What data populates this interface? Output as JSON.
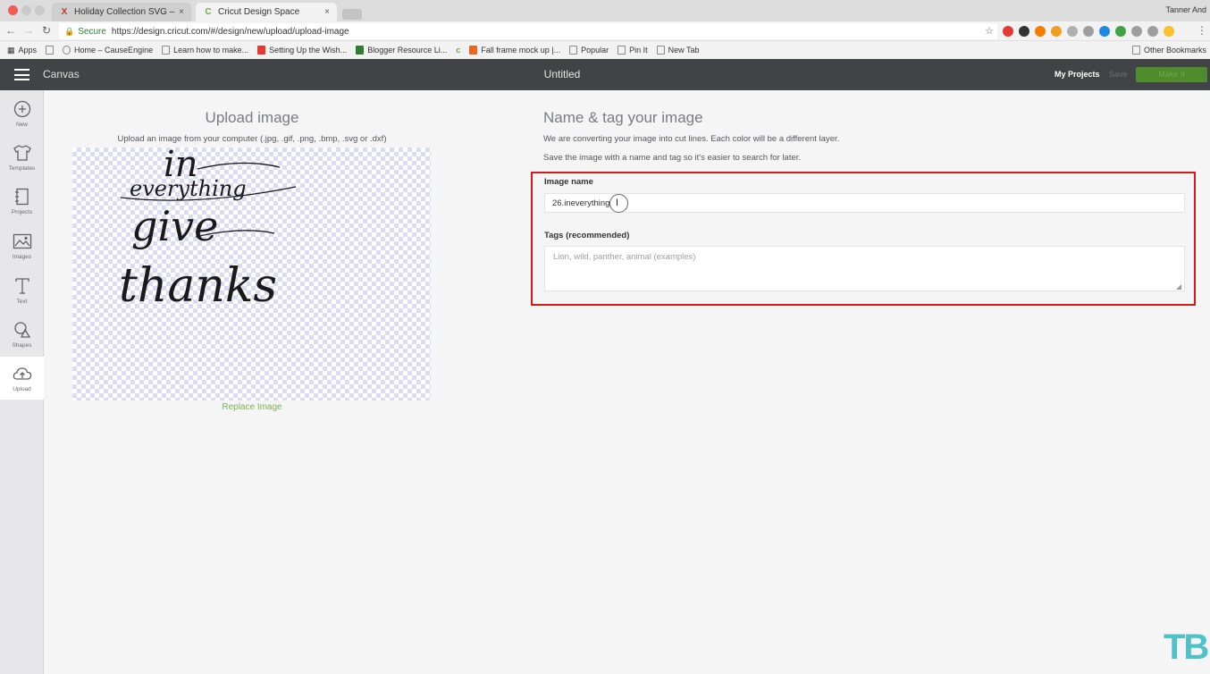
{
  "browser": {
    "tabs": [
      {
        "title": "Holiday Collection SVG – Maki",
        "icon": "X"
      },
      {
        "title": "Cricut Design Space",
        "icon": "C"
      }
    ],
    "user": "Tanner And",
    "secure_label": "Secure",
    "url": "https://design.cricut.com/#/design/new/upload/upload-image",
    "bookmarks": [
      {
        "label": "Apps"
      },
      {
        "label": ""
      },
      {
        "label": "Home – CauseEngine"
      },
      {
        "label": "Learn how to make..."
      },
      {
        "label": "Setting Up the Wish..."
      },
      {
        "label": "Blogger Resource Li..."
      },
      {
        "label": ""
      },
      {
        "label": "Fall frame mock up |..."
      },
      {
        "label": "Popular"
      },
      {
        "label": "Pin It"
      },
      {
        "label": "New Tab"
      }
    ],
    "other_bookmarks": "Other Bookmarks",
    "extension_colors": [
      "#e53935",
      "#333333",
      "#f57c00",
      "#f0a020",
      "#b0b0b0",
      "#9e9e9e",
      "#1e88e5",
      "#43a047",
      "#9e9e9e",
      "#9e9e9e",
      "#fbc02d"
    ]
  },
  "header": {
    "canvas_label": "Canvas",
    "doc_title": "Untitled",
    "my_projects": "My Projects",
    "save": "Save",
    "make_it": "Make It"
  },
  "sidebar": {
    "items": [
      {
        "label": "New",
        "icon": "plus-circle-icon"
      },
      {
        "label": "Templates",
        "icon": "shirt-icon"
      },
      {
        "label": "Projects",
        "icon": "notebook-icon"
      },
      {
        "label": "Images",
        "icon": "image-icon"
      },
      {
        "label": "Text",
        "icon": "text-icon"
      },
      {
        "label": "Shapes",
        "icon": "shapes-icon"
      },
      {
        "label": "Upload",
        "icon": "cloud-upload-icon"
      }
    ]
  },
  "upload": {
    "title": "Upload image",
    "subtitle": "Upload an image from your computer (.jpg, .gif, .png, .bmp, .svg or .dxf)",
    "lettering": [
      "in",
      "everything",
      "give",
      "thanks"
    ],
    "replace_link": "Replace Image"
  },
  "name_tag": {
    "title": "Name & tag your image",
    "desc1": "We are converting your image into cut lines. Each color will be a different layer.",
    "desc2": "Save the image with a name and tag so it's easier to search for later.",
    "image_name_label": "Image name",
    "image_name_value": "26.ineverything",
    "tags_label": "Tags (recommended)",
    "tags_placeholder": "Lion, wild, panther, animal (examples)"
  },
  "watermark": "TB"
}
